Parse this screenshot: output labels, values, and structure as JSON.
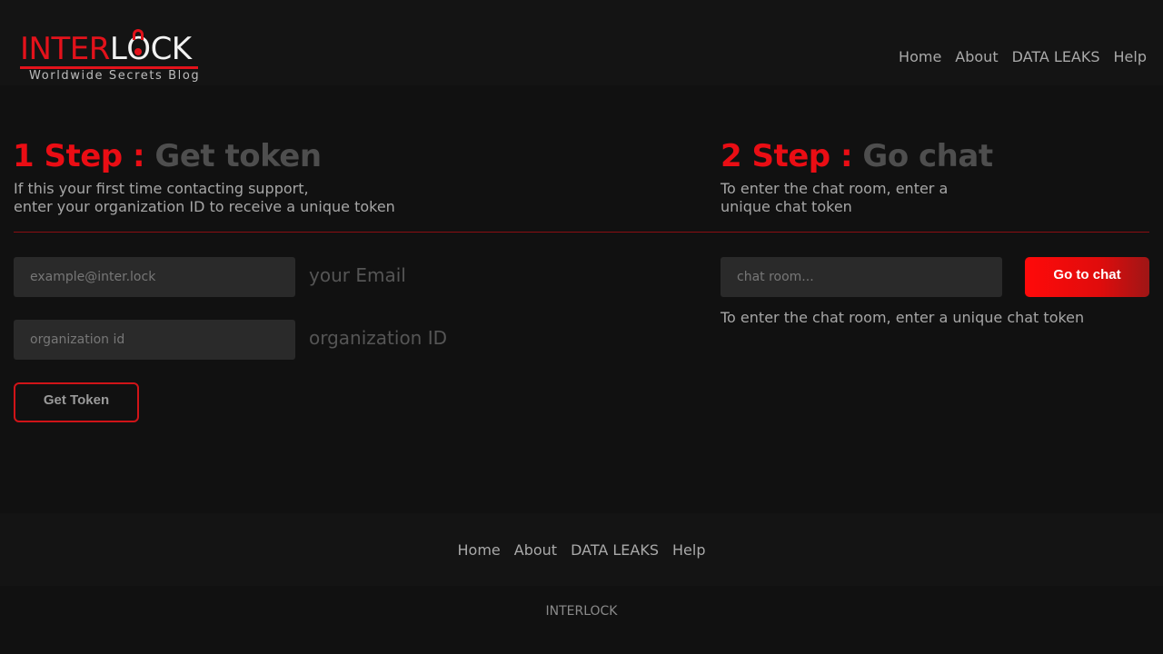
{
  "header": {
    "logo": {
      "part_red": "INTER",
      "part_white_1": "L",
      "part_white_o": "O",
      "part_white_2": "CK",
      "subtitle": "Worldwide Secrets Blog"
    },
    "nav": [
      "Home",
      "About",
      "DATA LEAKS",
      "Help"
    ]
  },
  "step1": {
    "number": "1 Step :",
    "name": "Get token",
    "desc_line1": "If this your first time contacting support,",
    "desc_line2": "enter your organization ID to receive a unique token",
    "email_placeholder": "example@inter.lock",
    "email_label": "your Email",
    "org_placeholder": "organization id",
    "org_label": "organization ID",
    "button": "Get Token"
  },
  "step2": {
    "number": "2 Step :",
    "name": "Go chat",
    "desc_line1": "To enter the chat room, enter a",
    "desc_line2": "unique chat token",
    "chat_placeholder": "chat room...",
    "button": "Go to chat",
    "note": "To enter the chat room, enter a unique chat token"
  },
  "footer": {
    "nav": [
      "Home",
      "About",
      "DATA LEAKS",
      "Help"
    ],
    "copyright": "INTERLOCK"
  },
  "colors": {
    "accent_red": "#e3121b",
    "background": "#111111"
  }
}
